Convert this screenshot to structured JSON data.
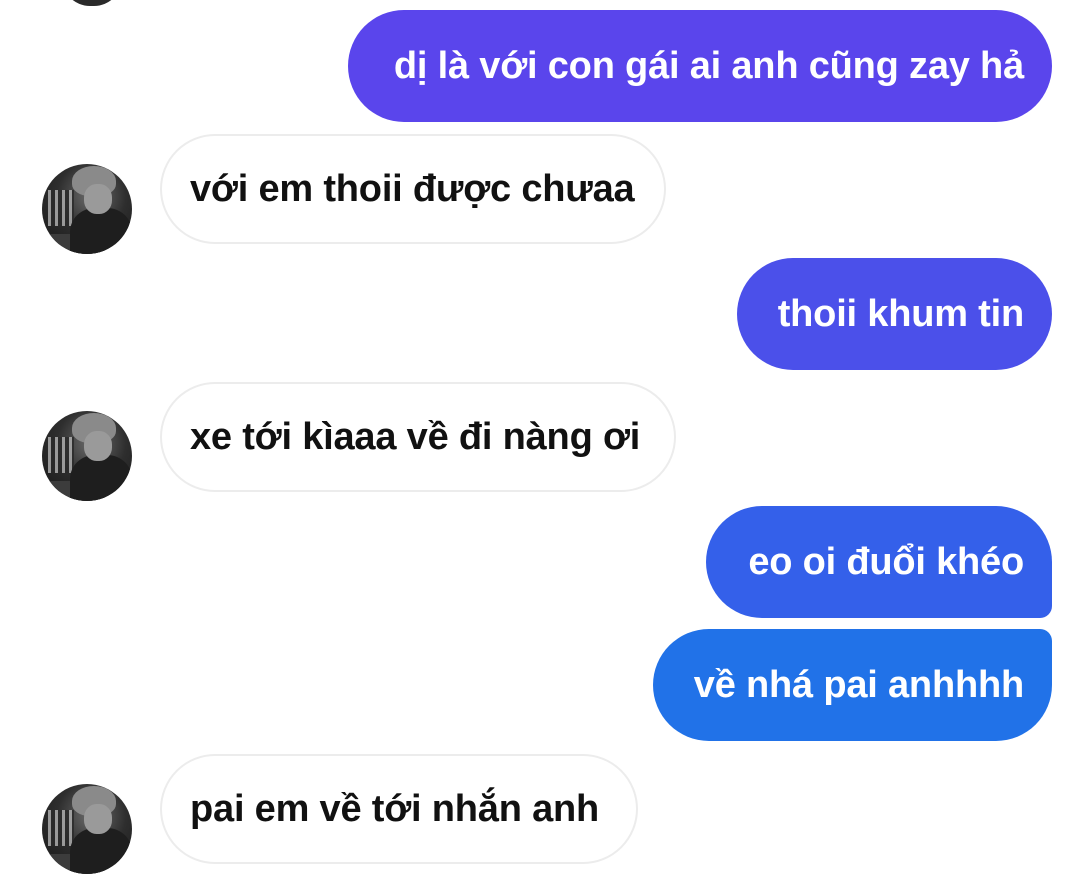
{
  "conversation": {
    "messages": [
      {
        "side": "out",
        "text": "dị là với con gái ai anh cũng zay hả"
      },
      {
        "side": "in",
        "text": "với em thoii được chưaa"
      },
      {
        "side": "out",
        "text": "thoii khum tin"
      },
      {
        "side": "in",
        "text": "xe tới kìaaa về đi nàng ơi"
      },
      {
        "side": "out",
        "text": "eo oi đuổi khéo"
      },
      {
        "side": "out",
        "text": "về nhá pai anhhhh"
      },
      {
        "side": "in",
        "text": "pai em về tới nhắn anh"
      }
    ]
  },
  "contact": {
    "avatar_icon": "profile-photo"
  },
  "colors": {
    "outgoing_gradient_top": "#5b44ec",
    "outgoing_gradient_bottom": "#1f78e8",
    "incoming_bg": "#ffffff",
    "incoming_border": "#ececec",
    "incoming_text": "#111111",
    "outgoing_text": "#ffffff"
  }
}
